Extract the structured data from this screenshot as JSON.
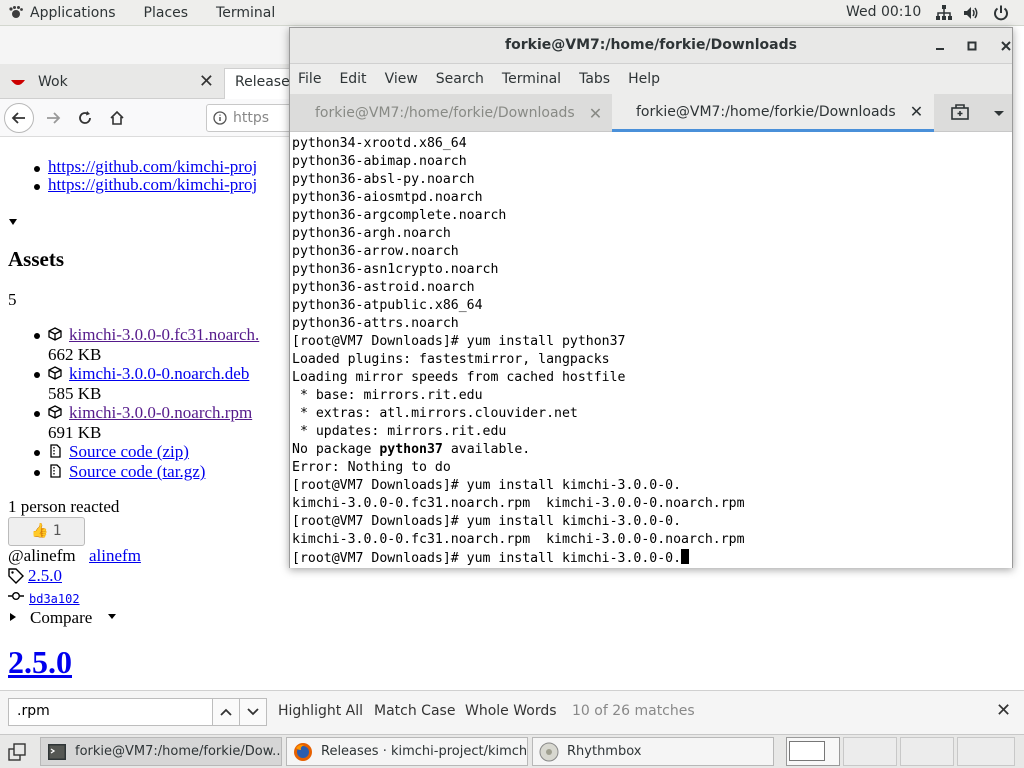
{
  "topbar": {
    "applications": "Applications",
    "places": "Places",
    "terminal": "Terminal",
    "clock": "Wed 00:10",
    "tray_icons": [
      "network-icon",
      "volume-icon",
      "power-icon"
    ]
  },
  "firefox": {
    "tab1_title": "Wok",
    "tab2_title": "Releases",
    "url_text": "https"
  },
  "page": {
    "link1": "https://github.com/kimchi-proj",
    "link2": "https://github.com/kimchi-proj",
    "assets_heading": "Assets",
    "assets_count": "5",
    "assets": [
      {
        "name": "kimchi-3.0.0-0.fc31.noarch.",
        "size": "662 KB"
      },
      {
        "name": "kimchi-3.0.0-0.noarch.deb",
        "size": "585 KB"
      },
      {
        "name": "kimchi-3.0.0-0.noarch.rpm",
        "size": "691 KB"
      }
    ],
    "source_zip": "Source code (zip)",
    "source_tar": "Source code (tar.gz)",
    "reacted": "1 person reacted",
    "reaction": "👍 1",
    "author_handle": "@alinefm",
    "author_link": "alinefm",
    "tag": "2.5.0",
    "commit": "bd3a102",
    "compare": "Compare",
    "release_heading": "2.5.0"
  },
  "findbar": {
    "query": ".rpm",
    "highlight_all": "Highlight All",
    "match_case": "Match Case",
    "whole_words": "Whole Words",
    "matches": "10 of 26 matches"
  },
  "terminal": {
    "title": "forkie@VM7:/home/forkie/Downloads",
    "menu": [
      "File",
      "Edit",
      "View",
      "Search",
      "Terminal",
      "Tabs",
      "Help"
    ],
    "tabs": [
      {
        "label": "forkie@VM7:/home/forkie/Downloads"
      },
      {
        "label": "forkie@VM7:/home/forkie/Downloads"
      }
    ],
    "lines": [
      "python34-xrootd.x86_64",
      "python36-abimap.noarch",
      "python36-absl-py.noarch",
      "python36-aiosmtpd.noarch",
      "python36-argcomplete.noarch",
      "python36-argh.noarch",
      "python36-arrow.noarch",
      "python36-asn1crypto.noarch",
      "python36-astroid.noarch",
      "python36-atpublic.x86_64",
      "python36-attrs.noarch",
      "[root@VM7 Downloads]# yum install python37",
      "Loaded plugins: fastestmirror, langpacks",
      "Loading mirror speeds from cached hostfile",
      " * base: mirrors.rit.edu",
      " * extras: atl.mirrors.clouvider.net",
      " * updates: mirrors.rit.edu",
      "No package ",
      "Error: Nothing to do",
      "[root@VM7 Downloads]# yum install kimchi-3.0.0-0.",
      "kimchi-3.0.0-0.fc31.noarch.rpm  kimchi-3.0.0-0.noarch.rpm",
      "[root@VM7 Downloads]# yum install kimchi-3.0.0-0.",
      "kimchi-3.0.0-0.fc31.noarch.rpm  kimchi-3.0.0-0.noarch.rpm",
      "[root@VM7 Downloads]# yum install kimchi-3.0.0-0."
    ],
    "bold_pkg": "python37",
    "available_suffix": " available."
  },
  "taskbar": {
    "tasks": [
      {
        "label": "forkie@VM7:/home/forkie/Dow..."
      },
      {
        "label": "Releases · kimchi-project/kimchi..."
      },
      {
        "label": "Rhythmbox"
      }
    ]
  }
}
